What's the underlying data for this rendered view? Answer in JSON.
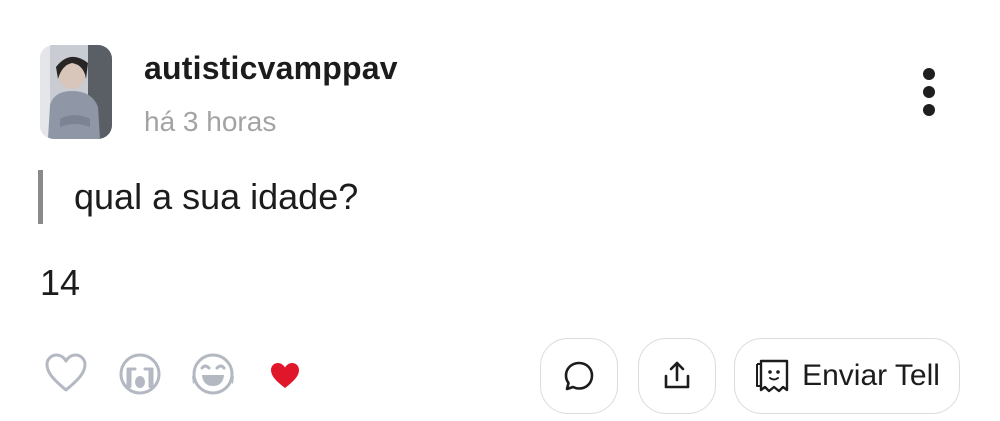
{
  "post": {
    "username": "autisticvamppav",
    "timestamp": "há 3 horas",
    "question": "qual a sua idade?",
    "answer": "14"
  },
  "actions": {
    "send_label": "Enviar Tell"
  },
  "icons": {
    "more": "more-vertical-icon",
    "like": "heart-outline-icon",
    "cry": "crying-face-icon",
    "laugh": "laughing-face-icon",
    "love": "red-heart-icon",
    "comment": "chat-bubble-icon",
    "share": "share-icon",
    "tell": "tell-paper-icon"
  },
  "colors": {
    "icon_gray": "#b3b8c2",
    "heart_red": "#e0162b",
    "text": "#1c1c1c",
    "muted_text": "#a3a3a3",
    "quote_bar": "#8a8a8a"
  }
}
